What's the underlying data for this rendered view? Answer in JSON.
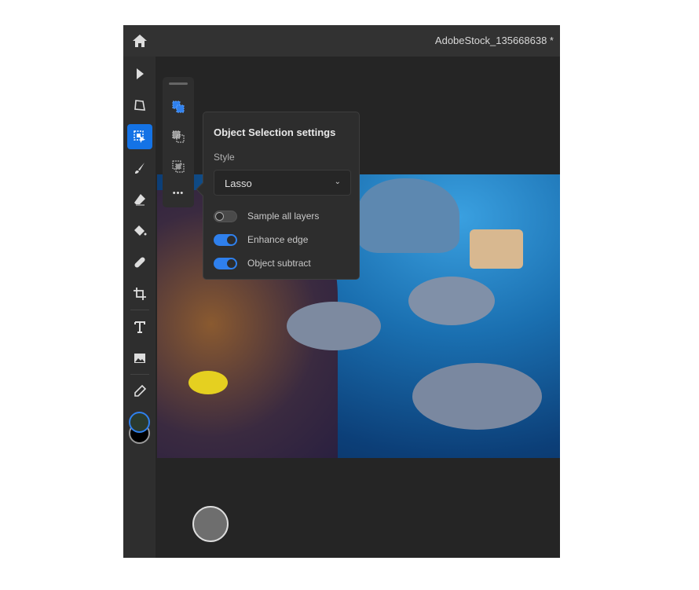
{
  "header": {
    "title": "AdobeStock_135668638 *",
    "home_icon": "home-icon"
  },
  "toolbar": {
    "tools": [
      "select-icon",
      "transform-icon",
      "object-selection-icon",
      "brush-icon",
      "eraser-icon",
      "fill-icon",
      "healing-icon",
      "crop-icon",
      "type-icon",
      "image-icon",
      "eyedropper-icon"
    ],
    "active": "object-selection-icon",
    "foreground_color": "#2a3a2e",
    "background_color": "#000000"
  },
  "subtoolbar": {
    "items": [
      "add-selection-icon",
      "subtract-selection-icon",
      "intersect-selection-icon",
      "more-icon"
    ],
    "more_label": "•••"
  },
  "popover": {
    "title": "Object Selection settings",
    "style_label": "Style",
    "style_value": "Lasso",
    "toggles": [
      {
        "label": "Sample all layers",
        "on": false
      },
      {
        "label": "Enhance edge",
        "on": true
      },
      {
        "label": "Object subtract",
        "on": true
      }
    ]
  },
  "colors": {
    "accent": "#1473e6",
    "toggle_on": "#2f80ed"
  }
}
